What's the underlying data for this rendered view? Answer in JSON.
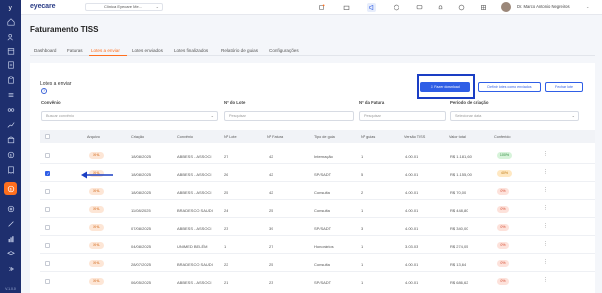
{
  "app": {
    "logo": "eyecare",
    "clinic": "Clínica Eyecare Me...",
    "user": "Dr. Marco Antonio Negreiros",
    "version": "V.1.0.0"
  },
  "page": {
    "title": "Faturamento TISS"
  },
  "tabs": [
    "Dashboard",
    "Faturas",
    "Lotes a enviar",
    "Lotes enviados",
    "Lotes finalizados",
    "Relatório de guias",
    "Configurações"
  ],
  "section": {
    "title": "Lotes a enviar",
    "help": "?"
  },
  "buttons": {
    "download": "Fazer download",
    "define_sent": "Definir lotes como enviados",
    "close_batch": "Fechar lote"
  },
  "filters": {
    "convenio": {
      "label": "Convênio",
      "placeholder": "Buscar convênio"
    },
    "lote": {
      "label": "Nº do Lote",
      "placeholder": "Pesquisar"
    },
    "fatura": {
      "label": "Nº da Fatura",
      "placeholder": "Pesquisar"
    },
    "periodo": {
      "label": "Período de criação",
      "placeholder": "Selecionar data"
    }
  },
  "table": {
    "headers": [
      "Arquivo",
      "Criação",
      "Convênio",
      "Nº Lote",
      "Nº Fatura",
      "Tipo de guia",
      "Nº guias",
      "Versão TISS",
      "Valor total",
      "Conferido"
    ],
    "rows": [
      {
        "file": "XHL",
        "date": "18/08/2025",
        "conv": "ABBESS - ASSOCI",
        "lote": "27",
        "fatura": "42",
        "tipo": "Internação",
        "guias": "1",
        "versao": "4.00.01",
        "valor": "R$ 1.181,60",
        "conf": "100%",
        "checked": false
      },
      {
        "file": "XHL",
        "date": "18/08/2025",
        "conv": "ABBESS - ASSOCI",
        "lote": "26",
        "fatura": "42",
        "tipo": "SP/SADT",
        "guias": "5",
        "versao": "4.00.01",
        "valor": "R$ 1.155,00",
        "conf": "40%",
        "checked": true
      },
      {
        "file": "XHL",
        "date": "18/08/2025",
        "conv": "ABBESS - ASSOCI",
        "lote": "25",
        "fatura": "42",
        "tipo": "Consulta",
        "guias": "2",
        "versao": "4.00.01",
        "valor": "R$ 70,00",
        "conf": "0%",
        "checked": false
      },
      {
        "file": "XHL",
        "date": "11/08/2025",
        "conv": "BRADESCO SAUDI",
        "lote": "24",
        "fatura": "25",
        "tipo": "Consulta",
        "guias": "1",
        "versao": "4.00.01",
        "valor": "R$ 448,80",
        "conf": "0%",
        "checked": false
      },
      {
        "file": "XHL",
        "date": "07/08/2025",
        "conv": "ABBESS - ASSOCI",
        "lote": "23",
        "fatura": "39",
        "tipo": "SP/SADT",
        "guias": "3",
        "versao": "4.00.01",
        "valor": "R$ 340,00",
        "conf": "0%",
        "checked": false
      },
      {
        "file": "XHL",
        "date": "04/08/2025",
        "conv": "UNIMED BELÉM",
        "lote": "1",
        "fatura": "27",
        "tipo": "Honorários",
        "guias": "1",
        "versao": "3.03.03",
        "valor": "R$ 274,05",
        "conf": "0%",
        "checked": false
      },
      {
        "file": "XHL",
        "date": "28/07/2025",
        "conv": "BRADESCO SAUDI",
        "lote": "22",
        "fatura": "25",
        "tipo": "Consulta",
        "guias": "1",
        "versao": "4.00.01",
        "valor": "R$ 13,64",
        "conf": "0%",
        "checked": false
      },
      {
        "file": "XHL",
        "date": "06/05/2025",
        "conv": "ABBESS - ASSOCI",
        "lote": "21",
        "fatura": "23",
        "tipo": "SP/SADT",
        "guias": "1",
        "versao": "4.00.01",
        "valor": "R$ 686,62",
        "conf": "0%",
        "checked": false
      }
    ]
  },
  "colors": {
    "accent": "#ff6f1e",
    "primary": "#2f5ee6",
    "sidebar": "#1e2f6e",
    "pct_full": "#d7f3da",
    "pct_partial": "#ffe8c2",
    "pct_zero": "#fde2db"
  }
}
